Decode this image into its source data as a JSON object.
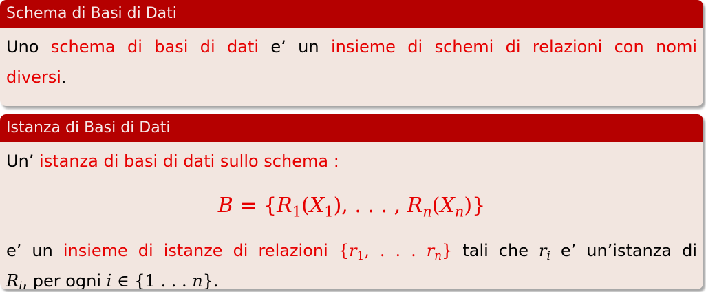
{
  "block1": {
    "title": "Schema di Basi di Dati",
    "line1_part1": "Uno ",
    "line1_red1": "schema di basi di dati",
    "line1_part2": " e’ un ",
    "line1_red2": "insieme di schemi di relazioni con nomi",
    "line2_red": "diversi",
    "line2_end": "."
  },
  "block2": {
    "title": "Istanza di Basi di Dati",
    "intro_part1": "Un’ ",
    "intro_red": "istanza di basi di dati sullo schema :",
    "formula": {
      "lhs": "B",
      "eq": " = {",
      "R1": "R",
      "sub1": "1",
      "X1open": "(",
      "X1": "X",
      "X1sub": "1",
      "X1close": ")",
      "dots": ", . . . , ",
      "Rn": "R",
      "subn": "n",
      "Xnopen": "(",
      "Xn": "X",
      "Xnsub": "n",
      "Xnclose": ")}"
    },
    "desc_part1": " e’ un ",
    "desc_red": "insieme di istanze di relazioni",
    "desc_set_open": " {",
    "desc_r1": "r",
    "desc_r1sub": "1",
    "desc_dots": ", . . . ",
    "desc_rn": "r",
    "desc_rnsub": "n",
    "desc_set_close": "}",
    "desc_part2": " tali che ",
    "desc_ri": "r",
    "desc_risub": "i",
    "desc_part3": " e’ un’istanza di",
    "line2_R": "R",
    "line2_Rsub": "i",
    "line2_part1": ", per ogni ",
    "line2_i": "i",
    "line2_in": " ∈ {1 . . . ",
    "line2_n": "n",
    "line2_close": "}."
  }
}
